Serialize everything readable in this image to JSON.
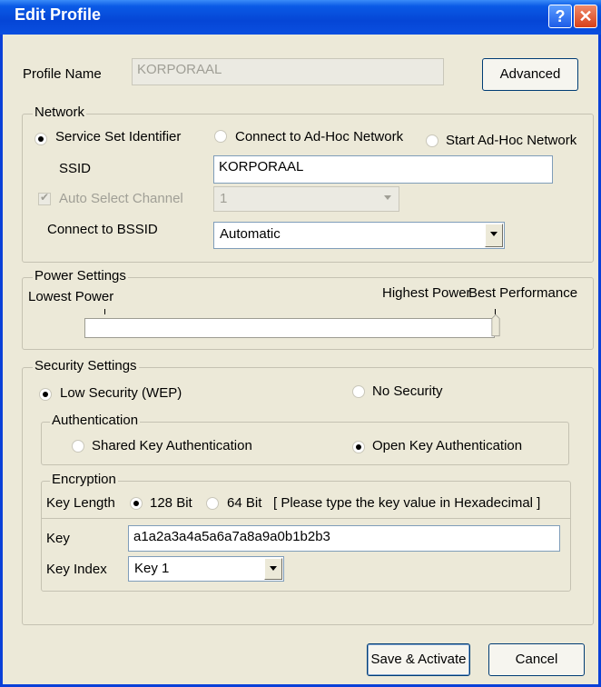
{
  "window": {
    "title": "Edit Profile",
    "help_glyph": "?",
    "close_glyph": "✕"
  },
  "profile": {
    "label": "Profile Name",
    "value": "KORPORAAL",
    "advanced_button": "Advanced"
  },
  "network": {
    "legend": "Network",
    "options": [
      {
        "label": "Service Set Identifier",
        "selected": true
      },
      {
        "label": "Connect to Ad-Hoc Network",
        "selected": false
      },
      {
        "label": "Start Ad-Hoc Network",
        "selected": false
      }
    ],
    "ssid_label": "SSID",
    "ssid_value": "KORPORAAL",
    "auto_channel_label": "Auto Select Channel",
    "auto_channel_checked": true,
    "channel_value": "1",
    "bssid_label": "Connect to BSSID",
    "bssid_value": "Automatic"
  },
  "power": {
    "legend": "Power Settings",
    "low_label": "Lowest Power",
    "high_label": "Highest Power",
    "best_label": "Best Performance",
    "level": 1.0
  },
  "security": {
    "legend": "Security Settings",
    "low_label": "Low Security (WEP)",
    "low_selected": true,
    "none_label": "No Security",
    "none_selected": false,
    "auth": {
      "legend": "Authentication",
      "shared_label": "Shared Key Authentication",
      "shared_selected": false,
      "open_label": "Open Key Authentication",
      "open_selected": true
    },
    "encryption": {
      "legend": "Encryption",
      "key_length_label": "Key Length",
      "bit128_label": "128 Bit",
      "bit128_selected": true,
      "bit64_label": "64 Bit",
      "bit64_selected": false,
      "hint": "[ Please type the key value in Hexadecimal ]",
      "key_label": "Key",
      "key_value": "a1a2a3a4a5a6a7a8a9a0b1b2b3",
      "key_index_label": "Key Index",
      "key_index_value": "Key 1"
    }
  },
  "footer": {
    "save_button": "Save & Activate",
    "cancel_button": "Cancel"
  }
}
